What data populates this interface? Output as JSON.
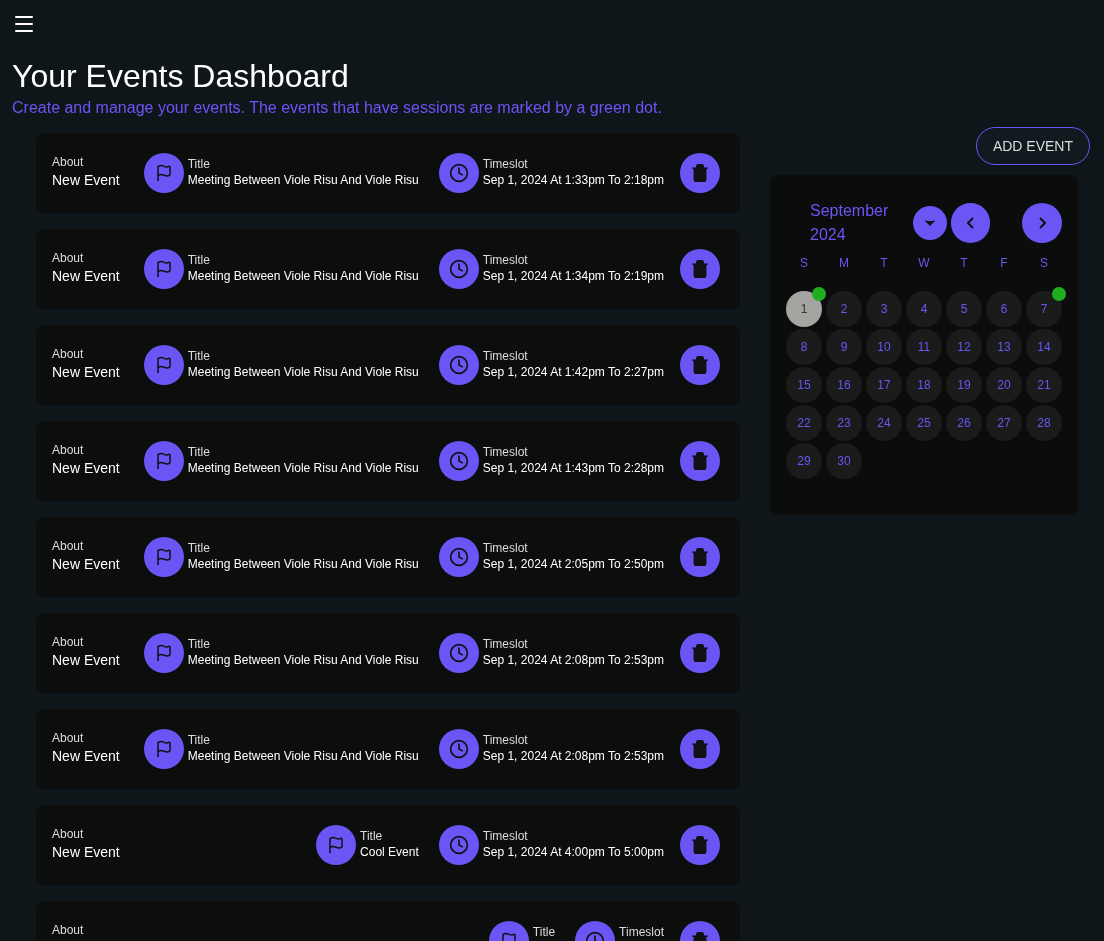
{
  "header": {
    "title": "Your Events Dashboard",
    "subtitle": "Create and manage your events. The events that have sessions are marked by a green dot."
  },
  "events": [
    {
      "about_label": "About",
      "about": "New Event",
      "title_label": "Title",
      "title": "Meeting Between Viole Risu And Viole Risu",
      "timeslot_label": "Timeslot",
      "timeslot": "Sep 1, 2024 At 1:33pm To 2:18pm"
    },
    {
      "about_label": "About",
      "about": "New Event",
      "title_label": "Title",
      "title": "Meeting Between Viole Risu And Viole Risu",
      "timeslot_label": "Timeslot",
      "timeslot": "Sep 1, 2024 At 1:34pm To 2:19pm"
    },
    {
      "about_label": "About",
      "about": "New Event",
      "title_label": "Title",
      "title": "Meeting Between Viole Risu And Viole Risu",
      "timeslot_label": "Timeslot",
      "timeslot": "Sep 1, 2024 At 1:42pm To 2:27pm"
    },
    {
      "about_label": "About",
      "about": "New Event",
      "title_label": "Title",
      "title": "Meeting Between Viole Risu And Viole Risu",
      "timeslot_label": "Timeslot",
      "timeslot": "Sep 1, 2024 At 1:43pm To 2:28pm"
    },
    {
      "about_label": "About",
      "about": "New Event",
      "title_label": "Title",
      "title": "Meeting Between Viole Risu And Viole Risu",
      "timeslot_label": "Timeslot",
      "timeslot": "Sep 1, 2024 At 2:05pm To 2:50pm"
    },
    {
      "about_label": "About",
      "about": "New Event",
      "title_label": "Title",
      "title": "Meeting Between Viole Risu And Viole Risu",
      "timeslot_label": "Timeslot",
      "timeslot": "Sep 1, 2024 At 2:08pm To 2:53pm"
    },
    {
      "about_label": "About",
      "about": "New Event",
      "title_label": "Title",
      "title": "Meeting Between Viole Risu And Viole Risu",
      "timeslot_label": "Timeslot",
      "timeslot": "Sep 1, 2024 At 2:08pm To 2:53pm"
    },
    {
      "about_label": "About",
      "about": "New Event",
      "title_label": "Title",
      "title": "Cool Event",
      "timeslot_label": "Timeslot",
      "timeslot": "Sep 1, 2024 At 4:00pm To 5:00pm"
    },
    {
      "about_label": "About",
      "title_label": "Title",
      "timeslot_label": "Timeslot"
    }
  ],
  "add_button": "ADD EVENT",
  "calendar": {
    "month": "September",
    "year": "2024",
    "weekdays": [
      "S",
      "M",
      "T",
      "W",
      "T",
      "F",
      "S"
    ],
    "days": [
      {
        "label": "1",
        "selected": true,
        "session": true
      },
      {
        "label": "2",
        "selected": false,
        "session": false
      },
      {
        "label": "3",
        "selected": false,
        "session": false
      },
      {
        "label": "4",
        "selected": false,
        "session": false
      },
      {
        "label": "5",
        "selected": false,
        "session": false
      },
      {
        "label": "6",
        "selected": false,
        "session": false
      },
      {
        "label": "7",
        "selected": false,
        "session": true
      },
      {
        "label": "8",
        "selected": false,
        "session": false
      },
      {
        "label": "9",
        "selected": false,
        "session": false
      },
      {
        "label": "10",
        "selected": false,
        "session": false
      },
      {
        "label": "11",
        "selected": false,
        "session": false
      },
      {
        "label": "12",
        "selected": false,
        "session": false
      },
      {
        "label": "13",
        "selected": false,
        "session": false
      },
      {
        "label": "14",
        "selected": false,
        "session": false
      },
      {
        "label": "15",
        "selected": false,
        "session": false
      },
      {
        "label": "16",
        "selected": false,
        "session": false
      },
      {
        "label": "17",
        "selected": false,
        "session": false
      },
      {
        "label": "18",
        "selected": false,
        "session": false
      },
      {
        "label": "19",
        "selected": false,
        "session": false
      },
      {
        "label": "20",
        "selected": false,
        "session": false
      },
      {
        "label": "21",
        "selected": false,
        "session": false
      },
      {
        "label": "22",
        "selected": false,
        "session": false
      },
      {
        "label": "23",
        "selected": false,
        "session": false
      },
      {
        "label": "24",
        "selected": false,
        "session": false
      },
      {
        "label": "25",
        "selected": false,
        "session": false
      },
      {
        "label": "26",
        "selected": false,
        "session": false
      },
      {
        "label": "27",
        "selected": false,
        "session": false
      },
      {
        "label": "28",
        "selected": false,
        "session": false
      },
      {
        "label": "29",
        "selected": false,
        "session": false
      },
      {
        "label": "30",
        "selected": false,
        "session": false
      }
    ]
  }
}
